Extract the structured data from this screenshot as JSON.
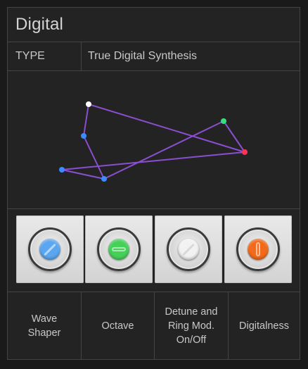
{
  "header": {
    "title": "Digital"
  },
  "type_row": {
    "label": "TYPE",
    "value": "True Digital Synthesis"
  },
  "graph": {
    "line_color": "#8a4fd0",
    "points": [
      {
        "id": "p-white",
        "color": "#ffffff"
      },
      {
        "id": "p-red",
        "color": "#ff3355"
      },
      {
        "id": "p-blue-a",
        "color": "#3a8cff"
      },
      {
        "id": "p-green",
        "color": "#33e07a"
      },
      {
        "id": "p-blue-b",
        "color": "#3a8cff"
      },
      {
        "id": "p-blue-c",
        "color": "#3a8cff"
      }
    ]
  },
  "knobs": [
    {
      "name": "wave-shaper",
      "color": "#5aa6f0",
      "pointer": "diagonal"
    },
    {
      "name": "octave",
      "color": "#46d05a",
      "pointer": "horizontal"
    },
    {
      "name": "detune-ring-mod",
      "color": "#f2f2f2",
      "pointer": "diagonal"
    },
    {
      "name": "digitalness",
      "color": "#f26a1a",
      "pointer": "vertical"
    }
  ],
  "labels": [
    {
      "text": "Wave\nShaper"
    },
    {
      "text": "Octave"
    },
    {
      "text": "Detune and\nRing Mod.\nOn/Off"
    },
    {
      "text": "Digitalness"
    }
  ]
}
